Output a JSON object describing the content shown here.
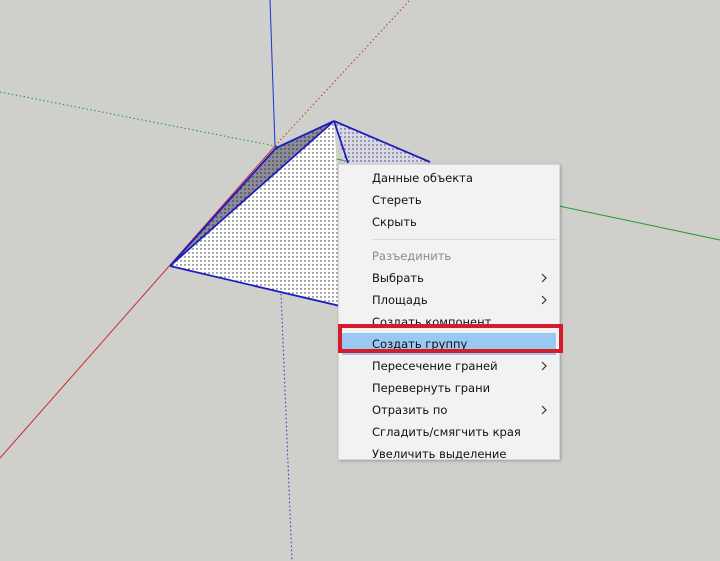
{
  "colors": {
    "background": "#cfcfcb",
    "axis_red": "#d12a2a",
    "axis_green": "#1f9a2a",
    "axis_blue": "#1f2fd1",
    "selection_edge": "#1d1dbf",
    "menu_bg": "#f2f2f2",
    "menu_highlight": "#99c9f2",
    "annotation_frame": "#d61b2b"
  },
  "context_menu": {
    "items": [
      {
        "label": "Данные объекта",
        "enabled": true,
        "submenu": false
      },
      {
        "label": "Стереть",
        "enabled": true,
        "submenu": false
      },
      {
        "label": "Скрыть",
        "enabled": true,
        "submenu": false
      },
      {
        "label": "Разъединить",
        "enabled": false,
        "submenu": false
      },
      {
        "label": "Выбрать",
        "enabled": true,
        "submenu": true
      },
      {
        "label": "Площадь",
        "enabled": true,
        "submenu": true
      },
      {
        "label": "Создать компонент...",
        "enabled": true,
        "submenu": false
      },
      {
        "label": "Создать группу",
        "enabled": true,
        "submenu": false,
        "highlighted": true
      },
      {
        "label": "Пересечение граней",
        "enabled": true,
        "submenu": true
      },
      {
        "label": "Перевернуть грани",
        "enabled": true,
        "submenu": false
      },
      {
        "label": "Отразить по",
        "enabled": true,
        "submenu": true
      },
      {
        "label": "Сгладить/смягчить края",
        "enabled": true,
        "submenu": false
      },
      {
        "label": "Увеличить выделение",
        "enabled": true,
        "submenu": false
      }
    ]
  }
}
